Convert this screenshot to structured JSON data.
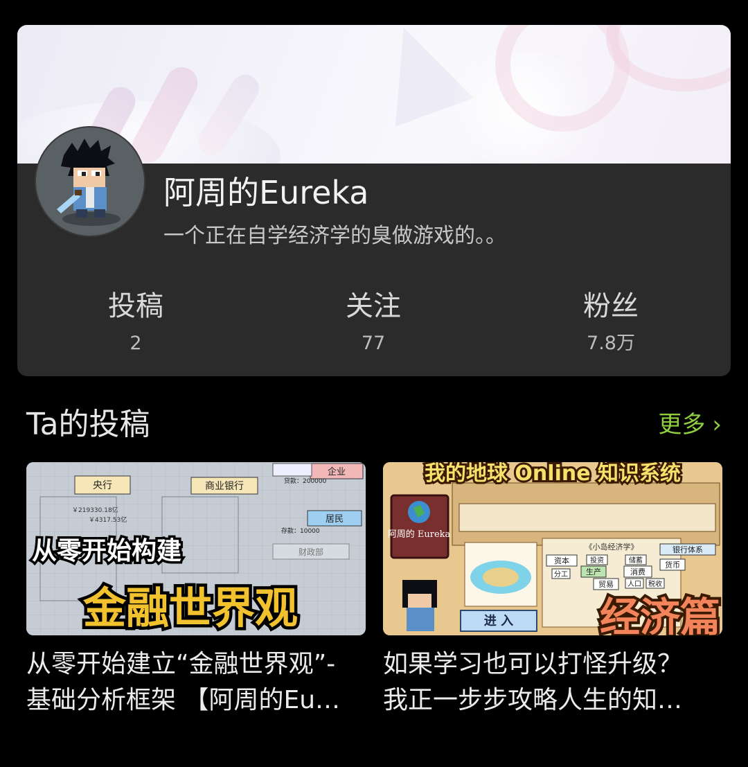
{
  "profile": {
    "username": "阿周的Eureka",
    "bio": "一个正在自学经济学的臭做游戏的。。"
  },
  "stats": [
    {
      "label": "投稿",
      "value": "2"
    },
    {
      "label": "关注",
      "value": "77"
    },
    {
      "label": "粉丝",
      "value": "7.8万"
    }
  ],
  "section": {
    "title": "Ta的投稿",
    "more_label": "更多",
    "more_icon": "chevron-right-icon"
  },
  "videos": [
    {
      "title_line1": "从零开始建立“金融世界观”-",
      "title_line2": "基础分析框架 【阿周的Eu…",
      "thumb_text_top": "从零开始构建",
      "thumb_text_main": "金融世界观",
      "thumb_labels": [
        "央行",
        "商业银行",
        "企业",
        "居民",
        "财政部",
        "贷款：200000",
        "存款：10000",
        "￥219330.18亿",
        "￥4317.53亿"
      ]
    },
    {
      "title_line1": "如果学习也可以打怪升级？",
      "title_line2": "我正一步步攻略人生的知…",
      "thumb_text_top": "我的地球 Online 知识系统",
      "thumb_text_main": "经济篇",
      "thumb_sign": "阿周的\nEureka",
      "thumb_button": "进 入",
      "thumb_panel_title": "《小岛经济学》",
      "thumb_labels": [
        "资本",
        "生产",
        "消费",
        "贸易",
        "货币",
        "银行体系",
        "投资",
        "储蓄",
        "人口",
        "税收",
        "分工"
      ]
    }
  ],
  "colors": {
    "accent": "#8fcf3f",
    "card_bg": "#2b2b2b",
    "page_bg": "#000000"
  }
}
